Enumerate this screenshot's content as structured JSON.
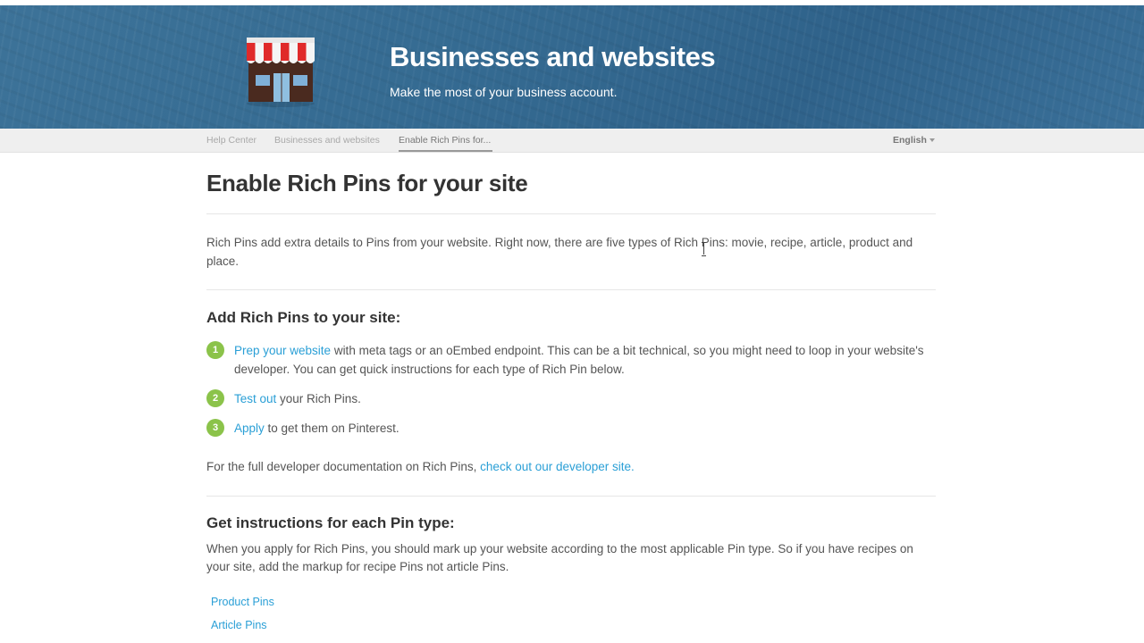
{
  "hero": {
    "title": "Businesses and websites",
    "subtitle": "Make the most of your business account.",
    "icon": "storefront-icon"
  },
  "breadcrumb": {
    "items": [
      "Help Center",
      "Businesses and websites",
      "Enable Rich Pins for..."
    ],
    "language": "English"
  },
  "article": {
    "title": "Enable Rich Pins for your site",
    "intro": "Rich Pins add extra details to Pins from your website. Right now, there are five types of Rich Pins: movie, recipe, article, product and place.",
    "add_heading": "Add Rich Pins to your site:",
    "steps": [
      {
        "number": "1",
        "link": "Prep your website",
        "text": " with meta tags or an oEmbed endpoint. This can be a bit technical, so you might need to loop in your website's developer. You can get quick instructions for each type of Rich Pin below."
      },
      {
        "number": "2",
        "link": "Test out",
        "text": " your Rich Pins."
      },
      {
        "number": "3",
        "link": "Apply",
        "text": " to get them on Pinterest."
      }
    ],
    "dev_prefix": "For the full developer documentation on Rich Pins, ",
    "dev_link": "check out our developer site.",
    "instructions_heading": "Get instructions for each Pin type:",
    "instructions_text": "When you apply for Rich Pins, you should mark up your website according to the most applicable Pin type. So if you have recipes on your site, add the markup for recipe Pins not article Pins.",
    "pin_types": [
      "Product Pins",
      "Article Pins"
    ]
  },
  "colors": {
    "hero_bg": "#356b92",
    "link": "#2a9fd6",
    "step_badge": "#8bc34a"
  }
}
